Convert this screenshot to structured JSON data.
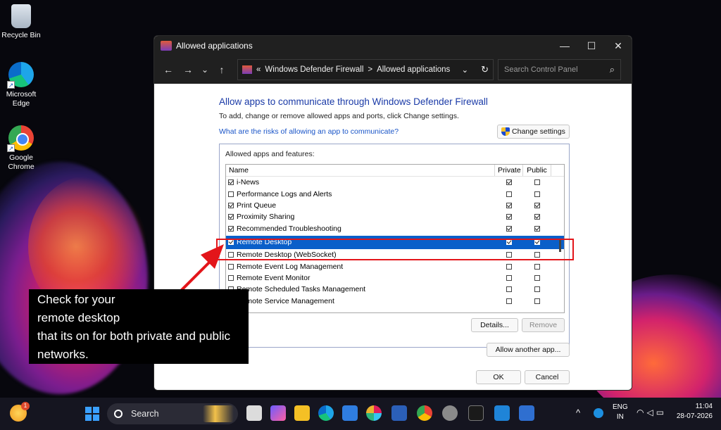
{
  "desktop": {
    "icons": [
      {
        "label": "Recycle Bin"
      },
      {
        "label": "Microsoft Edge"
      },
      {
        "label": "Google Chrome"
      }
    ]
  },
  "window": {
    "title": "Allowed applications",
    "controls": {
      "minimize": "—",
      "maximize": "☐",
      "close": "✕"
    },
    "nav": {
      "back": "←",
      "forward": "→",
      "dropdown": "⌄",
      "up": "↑",
      "refresh": "↻"
    },
    "address": {
      "prefix": "«",
      "crumbs": [
        "Windows Defender Firewall",
        ">",
        "Allowed applications"
      ],
      "dropdown": "⌄"
    },
    "search": {
      "placeholder": "Search Control Panel",
      "icon": "⌕"
    },
    "heading": "Allow apps to communicate through Windows Defender Firewall",
    "subtext": "To add, change or remove allowed apps and ports, click Change settings.",
    "risk_link": "What are the risks of allowing an app to communicate?",
    "change_settings": "Change settings",
    "group_label": "Allowed apps and features:",
    "columns": {
      "name": "Name",
      "private": "Private",
      "public": "Public"
    },
    "rows": [
      {
        "name": "i-News",
        "enabled": true,
        "private": true,
        "public": false
      },
      {
        "name": "Performance Logs and Alerts",
        "enabled": false,
        "private": false,
        "public": false
      },
      {
        "name": "Print Queue",
        "enabled": true,
        "private": true,
        "public": true
      },
      {
        "name": "Proximity Sharing",
        "enabled": true,
        "private": true,
        "public": true
      },
      {
        "name": "Recommended Troubleshooting",
        "enabled": true,
        "private": true,
        "public": true
      },
      {
        "name": "Remote Desktop",
        "enabled": true,
        "private": true,
        "public": true,
        "selected": true
      },
      {
        "name": "Remote Desktop (WebSocket)",
        "enabled": false,
        "private": false,
        "public": false
      },
      {
        "name": "Remote Event Log Management",
        "enabled": false,
        "private": false,
        "public": false
      },
      {
        "name": "Remote Event Monitor",
        "enabled": false,
        "private": false,
        "public": false
      },
      {
        "name": "Remote Scheduled Tasks Management",
        "enabled": false,
        "private": false,
        "public": false
      },
      {
        "name": "Remote Service Management",
        "enabled": false,
        "private": false,
        "public": false
      }
    ],
    "details_button": "Details...",
    "remove_button": "Remove",
    "allow_another": "Allow another app...",
    "ok_button": "OK",
    "cancel_button": "Cancel"
  },
  "annotation": {
    "lines": [
      "Check for your",
      "remote desktop",
      "that its on for both private and public",
      "networks."
    ]
  },
  "taskbar": {
    "search_label": "Search",
    "language": {
      "line1": "ENG",
      "line2": "IN"
    },
    "time": "11:04",
    "date": "28-07-2026",
    "notification_count": "1",
    "tray_chevron": "^"
  }
}
